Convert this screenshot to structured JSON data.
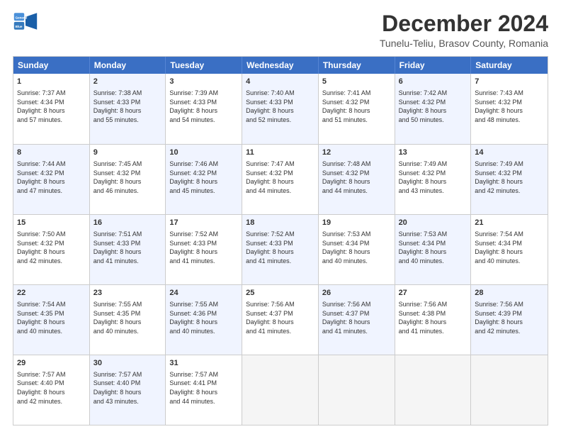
{
  "header": {
    "logo_general": "General",
    "logo_blue": "Blue",
    "main_title": "December 2024",
    "subtitle": "Tunelu-Teliu, Brasov County, Romania"
  },
  "calendar": {
    "days": [
      "Sunday",
      "Monday",
      "Tuesday",
      "Wednesday",
      "Thursday",
      "Friday",
      "Saturday"
    ],
    "rows": [
      [
        {
          "day": "1",
          "content": "Sunrise: 7:37 AM\nSunset: 4:34 PM\nDaylight: 8 hours\nand 57 minutes.",
          "shaded": false
        },
        {
          "day": "2",
          "content": "Sunrise: 7:38 AM\nSunset: 4:33 PM\nDaylight: 8 hours\nand 55 minutes.",
          "shaded": true
        },
        {
          "day": "3",
          "content": "Sunrise: 7:39 AM\nSunset: 4:33 PM\nDaylight: 8 hours\nand 54 minutes.",
          "shaded": false
        },
        {
          "day": "4",
          "content": "Sunrise: 7:40 AM\nSunset: 4:33 PM\nDaylight: 8 hours\nand 52 minutes.",
          "shaded": true
        },
        {
          "day": "5",
          "content": "Sunrise: 7:41 AM\nSunset: 4:32 PM\nDaylight: 8 hours\nand 51 minutes.",
          "shaded": false
        },
        {
          "day": "6",
          "content": "Sunrise: 7:42 AM\nSunset: 4:32 PM\nDaylight: 8 hours\nand 50 minutes.",
          "shaded": true
        },
        {
          "day": "7",
          "content": "Sunrise: 7:43 AM\nSunset: 4:32 PM\nDaylight: 8 hours\nand 48 minutes.",
          "shaded": false
        }
      ],
      [
        {
          "day": "8",
          "content": "Sunrise: 7:44 AM\nSunset: 4:32 PM\nDaylight: 8 hours\nand 47 minutes.",
          "shaded": true
        },
        {
          "day": "9",
          "content": "Sunrise: 7:45 AM\nSunset: 4:32 PM\nDaylight: 8 hours\nand 46 minutes.",
          "shaded": false
        },
        {
          "day": "10",
          "content": "Sunrise: 7:46 AM\nSunset: 4:32 PM\nDaylight: 8 hours\nand 45 minutes.",
          "shaded": true
        },
        {
          "day": "11",
          "content": "Sunrise: 7:47 AM\nSunset: 4:32 PM\nDaylight: 8 hours\nand 44 minutes.",
          "shaded": false
        },
        {
          "day": "12",
          "content": "Sunrise: 7:48 AM\nSunset: 4:32 PM\nDaylight: 8 hours\nand 44 minutes.",
          "shaded": true
        },
        {
          "day": "13",
          "content": "Sunrise: 7:49 AM\nSunset: 4:32 PM\nDaylight: 8 hours\nand 43 minutes.",
          "shaded": false
        },
        {
          "day": "14",
          "content": "Sunrise: 7:49 AM\nSunset: 4:32 PM\nDaylight: 8 hours\nand 42 minutes.",
          "shaded": true
        }
      ],
      [
        {
          "day": "15",
          "content": "Sunrise: 7:50 AM\nSunset: 4:32 PM\nDaylight: 8 hours\nand 42 minutes.",
          "shaded": false
        },
        {
          "day": "16",
          "content": "Sunrise: 7:51 AM\nSunset: 4:33 PM\nDaylight: 8 hours\nand 41 minutes.",
          "shaded": true
        },
        {
          "day": "17",
          "content": "Sunrise: 7:52 AM\nSunset: 4:33 PM\nDaylight: 8 hours\nand 41 minutes.",
          "shaded": false
        },
        {
          "day": "18",
          "content": "Sunrise: 7:52 AM\nSunset: 4:33 PM\nDaylight: 8 hours\nand 41 minutes.",
          "shaded": true
        },
        {
          "day": "19",
          "content": "Sunrise: 7:53 AM\nSunset: 4:34 PM\nDaylight: 8 hours\nand 40 minutes.",
          "shaded": false
        },
        {
          "day": "20",
          "content": "Sunrise: 7:53 AM\nSunset: 4:34 PM\nDaylight: 8 hours\nand 40 minutes.",
          "shaded": true
        },
        {
          "day": "21",
          "content": "Sunrise: 7:54 AM\nSunset: 4:34 PM\nDaylight: 8 hours\nand 40 minutes.",
          "shaded": false
        }
      ],
      [
        {
          "day": "22",
          "content": "Sunrise: 7:54 AM\nSunset: 4:35 PM\nDaylight: 8 hours\nand 40 minutes.",
          "shaded": true
        },
        {
          "day": "23",
          "content": "Sunrise: 7:55 AM\nSunset: 4:35 PM\nDaylight: 8 hours\nand 40 minutes.",
          "shaded": false
        },
        {
          "day": "24",
          "content": "Sunrise: 7:55 AM\nSunset: 4:36 PM\nDaylight: 8 hours\nand 40 minutes.",
          "shaded": true
        },
        {
          "day": "25",
          "content": "Sunrise: 7:56 AM\nSunset: 4:37 PM\nDaylight: 8 hours\nand 41 minutes.",
          "shaded": false
        },
        {
          "day": "26",
          "content": "Sunrise: 7:56 AM\nSunset: 4:37 PM\nDaylight: 8 hours\nand 41 minutes.",
          "shaded": true
        },
        {
          "day": "27",
          "content": "Sunrise: 7:56 AM\nSunset: 4:38 PM\nDaylight: 8 hours\nand 41 minutes.",
          "shaded": false
        },
        {
          "day": "28",
          "content": "Sunrise: 7:56 AM\nSunset: 4:39 PM\nDaylight: 8 hours\nand 42 minutes.",
          "shaded": true
        }
      ],
      [
        {
          "day": "29",
          "content": "Sunrise: 7:57 AM\nSunset: 4:40 PM\nDaylight: 8 hours\nand 42 minutes.",
          "shaded": false
        },
        {
          "day": "30",
          "content": "Sunrise: 7:57 AM\nSunset: 4:40 PM\nDaylight: 8 hours\nand 43 minutes.",
          "shaded": true
        },
        {
          "day": "31",
          "content": "Sunrise: 7:57 AM\nSunset: 4:41 PM\nDaylight: 8 hours\nand 44 minutes.",
          "shaded": false
        },
        {
          "day": "",
          "content": "",
          "shaded": true,
          "empty": true
        },
        {
          "day": "",
          "content": "",
          "shaded": false,
          "empty": true
        },
        {
          "day": "",
          "content": "",
          "shaded": true,
          "empty": true
        },
        {
          "day": "",
          "content": "",
          "shaded": false,
          "empty": true
        }
      ]
    ]
  }
}
